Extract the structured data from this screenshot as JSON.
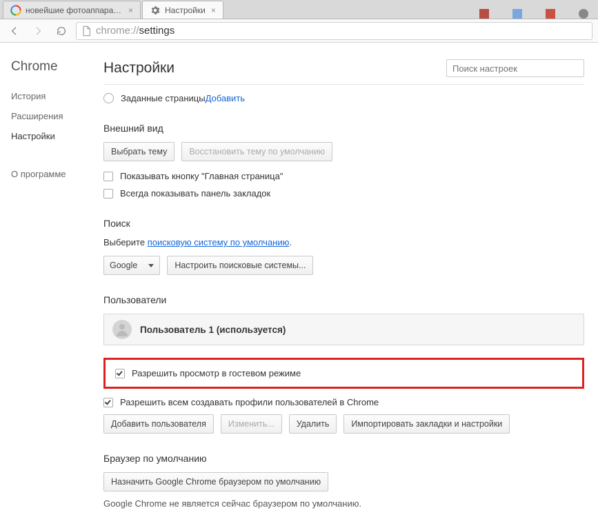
{
  "tabs": {
    "inactive": {
      "title": "новейшие фотоаппараты"
    },
    "active": {
      "title": "Настройки"
    }
  },
  "shelf": {
    "i0": "",
    "i1": "",
    "i2": "",
    "i3": ""
  },
  "address": {
    "prefix": "chrome://",
    "path": "settings"
  },
  "sidebar": {
    "brand": "Chrome",
    "history": "История",
    "extensions": "Расширения",
    "settings": "Настройки",
    "about": "О программе"
  },
  "main": {
    "title": "Настройки",
    "search_placeholder": "Поиск настроек"
  },
  "startup": {
    "radio_label": "Заданные страницы ",
    "add_link": "Добавить"
  },
  "appearance": {
    "heading": "Внешний вид",
    "choose_theme": "Выбрать тему",
    "restore_theme": "Восстановить тему по умолчанию",
    "show_home": "Показывать кнопку \"Главная страница\"",
    "show_bookmarks": "Всегда показывать панель закладок"
  },
  "search": {
    "heading": "Поиск",
    "prefix": "Выберите ",
    "link": "поисковую систему по умолчанию",
    "selected": "Google",
    "manage": "Настроить поисковые системы..."
  },
  "users": {
    "heading": "Пользователи",
    "current": "Пользователь 1 (используется)",
    "guest": "Разрешить просмотр в гостевом режиме",
    "anyone_create": "Разрешить всем создавать профили пользователей в Chrome",
    "add": "Добавить пользователя",
    "edit": "Изменить...",
    "delete": "Удалить",
    "import": "Импортировать закладки и настройки"
  },
  "default_browser": {
    "heading": "Браузер по умолчанию",
    "set": "Назначить Google Chrome браузером по умолчанию",
    "note": "Google Chrome не является сейчас браузером по умолчанию."
  }
}
